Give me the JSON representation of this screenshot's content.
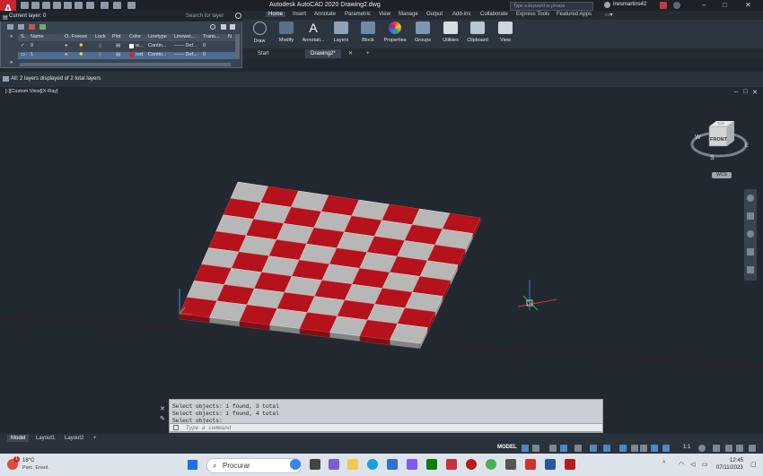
{
  "app": {
    "logo": "A",
    "title": "Autodesk AutoCAD 2020   Drawing2.dwg",
    "search_placeholder": "Type a keyword or phrase",
    "user": "inesmartins42",
    "window_controls": [
      "–",
      "□",
      "✕"
    ]
  },
  "ribbon": {
    "tabs": [
      "Home",
      "Insert",
      "Annotate",
      "Parametric",
      "View",
      "Manage",
      "Output",
      "Add-ins",
      "Collaborate",
      "Express Tools",
      "Featured Apps"
    ],
    "active_tab": "Home",
    "buttons": [
      "Draw",
      "Modify",
      "Annotati...",
      "Layers",
      "Block",
      "Properties",
      "Groups",
      "Utilities",
      "Clipboard",
      "View"
    ]
  },
  "file_tabs": {
    "start": "Start",
    "drawing": "Drawing2*",
    "close": "✕",
    "add": "+"
  },
  "layer_panel": {
    "current_layer": "Current layer: 0",
    "search_placeholder": "Search for layer",
    "columns": [
      "S..",
      "Name",
      "O..",
      "Freeze",
      "Lock",
      "Plot",
      "Color",
      "Linetype",
      "Linewei...",
      "Trans...",
      "N"
    ],
    "rows": [
      {
        "status": "✔",
        "name": "0",
        "color_name": "w...",
        "color_hex": "#ffffff",
        "linetype": "Contin...",
        "lineweight": "—— Def...",
        "transparency": "0"
      },
      {
        "status": "▭",
        "name": "1",
        "color_name": "red",
        "color_hex": "#e0202a",
        "linetype": "Contin...",
        "lineweight": "—— Def...",
        "transparency": "0"
      }
    ],
    "summary": "All: 2 layers displayed of 2 total layers"
  },
  "viewport": {
    "label": "[-][Custom View][X-Ray]",
    "controls": [
      "–",
      "□",
      "✕"
    ],
    "viewcube_face": "FRONT",
    "viewcube_top": "TOP",
    "compass_w": "W",
    "compass_e": "E",
    "compass_s": "S",
    "ucs": "WCS"
  },
  "command": {
    "history": [
      "Select objects: 1 found, 3 total",
      "Select objects: 1 found, 4 total",
      "Select objects:"
    ],
    "placeholder": "Type a command"
  },
  "layout_tabs": {
    "tabs": [
      "Model",
      "Layout1",
      "Layout2"
    ],
    "active": "Model",
    "add": "+"
  },
  "status_bar": {
    "model": "MODEL",
    "scale": "1:1"
  },
  "taskbar": {
    "temperature": "18°C",
    "weather": "Parc. Ensol.",
    "search": "Procurar",
    "time": "12:45",
    "date": "07/11/2023",
    "notification_count": "1"
  },
  "colors": {
    "accent_red": "#b5121b",
    "tile_grey": "#b7b7b7",
    "background": "#212830"
  }
}
